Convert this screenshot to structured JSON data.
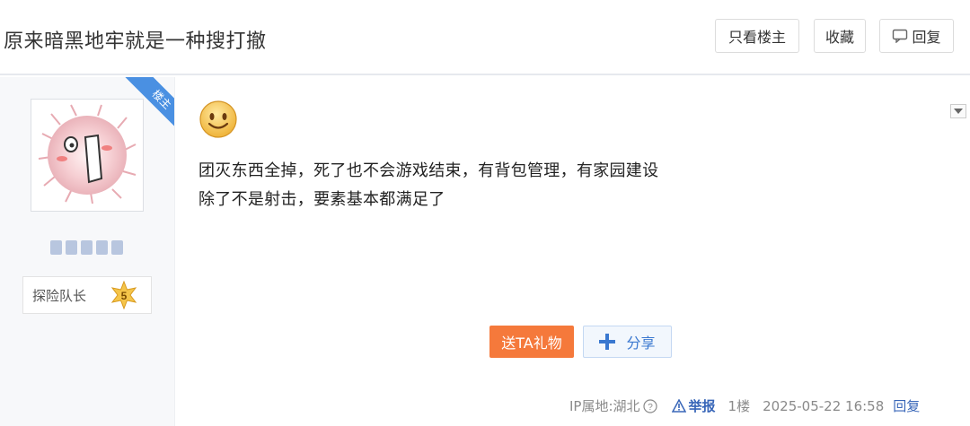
{
  "header": {
    "title": "原来暗黑地牢就是一种搜打撤",
    "only_op_label": "只看楼主",
    "collect_label": "收藏",
    "reply_label": "回复",
    "reply_icon": "speech-bubble-icon"
  },
  "author": {
    "op_badge": "楼主",
    "rank_title": "探险队长",
    "rank_level": "5",
    "avatar_icon": "fluffy-creature-avatar"
  },
  "post": {
    "emoji_icon": "smiley-face-icon",
    "lines": [
      "团灭东西全掉，死了也不会游戏结束，有背包管理，有家园建设",
      "除了不是射击，要素基本都满足了"
    ],
    "menu_icon": "caret-down-icon"
  },
  "actions": {
    "gift_label": "送TA礼物",
    "share_label": "分享"
  },
  "footer": {
    "ip_location": "IP属地:湖北",
    "report_label": "举报",
    "floor": "1楼",
    "timestamp": "2025-05-22 16:58",
    "reply_label": "回复"
  },
  "colors": {
    "accent_orange": "#f5793b",
    "link_blue": "#3866b8",
    "badge_blue": "#4a90e2"
  }
}
